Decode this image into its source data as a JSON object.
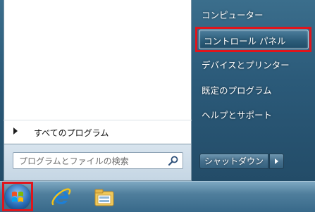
{
  "right_pane": {
    "items": [
      {
        "label": "コンピューター"
      },
      {
        "label": "コントロール パネル"
      },
      {
        "label": "デバイスとプリンター"
      },
      {
        "label": "既定のプログラム"
      },
      {
        "label": "ヘルプとサポート"
      }
    ],
    "shutdown_label": "シャットダウン"
  },
  "left_pane": {
    "all_programs_label": "すべてのプログラム",
    "search_placeholder": "プログラムとファイルの検索"
  },
  "taskbar": {
    "icons": [
      "start-orb-icon",
      "internet-explorer-icon",
      "windows-explorer-icon"
    ]
  },
  "colors": {
    "highlight": "#e0151c",
    "menu_background": "#2b5a79"
  }
}
